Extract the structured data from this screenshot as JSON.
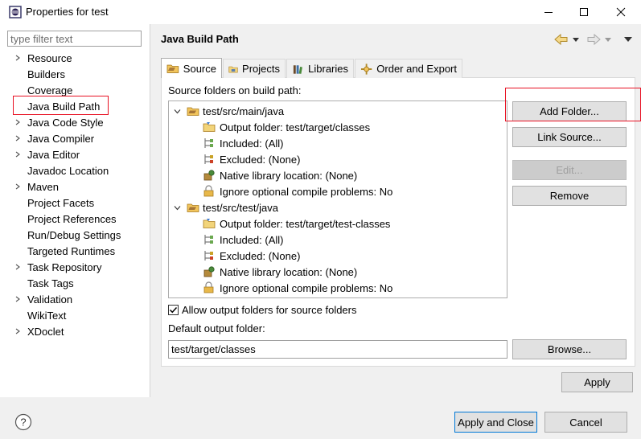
{
  "window": {
    "title": "Properties for test"
  },
  "filter": {
    "placeholder": "type filter text"
  },
  "nav": {
    "items": [
      {
        "label": "Resource",
        "expandable": true
      },
      {
        "label": "Builders",
        "expandable": false
      },
      {
        "label": "Coverage",
        "expandable": false
      },
      {
        "label": "Java Build Path",
        "expandable": false,
        "selected": true
      },
      {
        "label": "Java Code Style",
        "expandable": true
      },
      {
        "label": "Java Compiler",
        "expandable": true
      },
      {
        "label": "Java Editor",
        "expandable": true
      },
      {
        "label": "Javadoc Location",
        "expandable": false
      },
      {
        "label": "Maven",
        "expandable": true
      },
      {
        "label": "Project Facets",
        "expandable": false
      },
      {
        "label": "Project References",
        "expandable": false
      },
      {
        "label": "Run/Debug Settings",
        "expandable": false
      },
      {
        "label": "Targeted Runtimes",
        "expandable": false
      },
      {
        "label": "Task Repository",
        "expandable": true
      },
      {
        "label": "Task Tags",
        "expandable": false
      },
      {
        "label": "Validation",
        "expandable": true
      },
      {
        "label": "WikiText",
        "expandable": false
      },
      {
        "label": "XDoclet",
        "expandable": true
      }
    ]
  },
  "page": {
    "title": "Java Build Path"
  },
  "tabs": [
    {
      "label": "Source",
      "icon": "source-folder-icon",
      "active": true
    },
    {
      "label": "Projects",
      "icon": "projects-icon",
      "active": false
    },
    {
      "label": "Libraries",
      "icon": "libraries-icon",
      "active": false
    },
    {
      "label": "Order and Export",
      "icon": "order-export-icon",
      "active": false
    }
  ],
  "source": {
    "tree_label": "Source folders on build path:",
    "folders": [
      {
        "path": "test/src/main/java",
        "children": [
          {
            "label": "Output folder: test/target/classes",
            "icon": "output-folder-icon"
          },
          {
            "label": "Included: (All)",
            "icon": "included-icon"
          },
          {
            "label": "Excluded: (None)",
            "icon": "excluded-icon"
          },
          {
            "label": "Native library location: (None)",
            "icon": "native-library-icon"
          },
          {
            "label": "Ignore optional compile problems: No",
            "icon": "ignore-problems-icon"
          }
        ]
      },
      {
        "path": "test/src/test/java",
        "children": [
          {
            "label": "Output folder: test/target/test-classes",
            "icon": "output-folder-icon"
          },
          {
            "label": "Included: (All)",
            "icon": "included-icon"
          },
          {
            "label": "Excluded: (None)",
            "icon": "excluded-icon"
          },
          {
            "label": "Native library location: (None)",
            "icon": "native-library-icon"
          },
          {
            "label": "Ignore optional compile problems: No",
            "icon": "ignore-problems-icon"
          }
        ]
      }
    ],
    "buttons": {
      "add_folder": "Add Folder...",
      "link_source": "Link Source...",
      "edit": "Edit...",
      "remove": "Remove"
    },
    "allow_output_folders": {
      "label": "Allow output folders for source folders",
      "checked": true
    },
    "default_output_label": "Default output folder:",
    "default_output_value": "test/target/classes",
    "browse": "Browse..."
  },
  "footer": {
    "apply": "Apply",
    "apply_and_close": "Apply and Close",
    "cancel": "Cancel"
  },
  "colors": {
    "highlight_border": "#e81123",
    "default_button_border": "#0078d7",
    "folder_yellow": "#e8b84a"
  }
}
